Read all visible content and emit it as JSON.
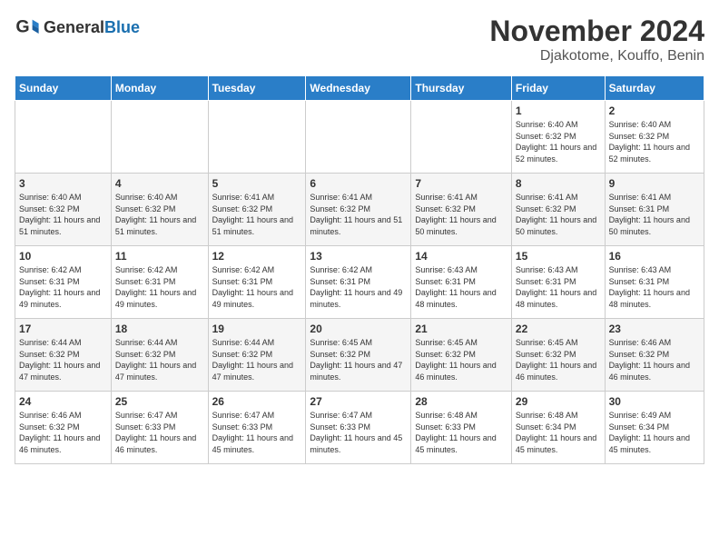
{
  "header": {
    "logo_general": "General",
    "logo_blue": "Blue",
    "month": "November 2024",
    "location": "Djakotome, Kouffo, Benin"
  },
  "days_of_week": [
    "Sunday",
    "Monday",
    "Tuesday",
    "Wednesday",
    "Thursday",
    "Friday",
    "Saturday"
  ],
  "weeks": [
    [
      {
        "day": "",
        "info": ""
      },
      {
        "day": "",
        "info": ""
      },
      {
        "day": "",
        "info": ""
      },
      {
        "day": "",
        "info": ""
      },
      {
        "day": "",
        "info": ""
      },
      {
        "day": "1",
        "info": "Sunrise: 6:40 AM\nSunset: 6:32 PM\nDaylight: 11 hours and 52 minutes."
      },
      {
        "day": "2",
        "info": "Sunrise: 6:40 AM\nSunset: 6:32 PM\nDaylight: 11 hours and 52 minutes."
      }
    ],
    [
      {
        "day": "3",
        "info": "Sunrise: 6:40 AM\nSunset: 6:32 PM\nDaylight: 11 hours and 51 minutes."
      },
      {
        "day": "4",
        "info": "Sunrise: 6:40 AM\nSunset: 6:32 PM\nDaylight: 11 hours and 51 minutes."
      },
      {
        "day": "5",
        "info": "Sunrise: 6:41 AM\nSunset: 6:32 PM\nDaylight: 11 hours and 51 minutes."
      },
      {
        "day": "6",
        "info": "Sunrise: 6:41 AM\nSunset: 6:32 PM\nDaylight: 11 hours and 51 minutes."
      },
      {
        "day": "7",
        "info": "Sunrise: 6:41 AM\nSunset: 6:32 PM\nDaylight: 11 hours and 50 minutes."
      },
      {
        "day": "8",
        "info": "Sunrise: 6:41 AM\nSunset: 6:32 PM\nDaylight: 11 hours and 50 minutes."
      },
      {
        "day": "9",
        "info": "Sunrise: 6:41 AM\nSunset: 6:31 PM\nDaylight: 11 hours and 50 minutes."
      }
    ],
    [
      {
        "day": "10",
        "info": "Sunrise: 6:42 AM\nSunset: 6:31 PM\nDaylight: 11 hours and 49 minutes."
      },
      {
        "day": "11",
        "info": "Sunrise: 6:42 AM\nSunset: 6:31 PM\nDaylight: 11 hours and 49 minutes."
      },
      {
        "day": "12",
        "info": "Sunrise: 6:42 AM\nSunset: 6:31 PM\nDaylight: 11 hours and 49 minutes."
      },
      {
        "day": "13",
        "info": "Sunrise: 6:42 AM\nSunset: 6:31 PM\nDaylight: 11 hours and 49 minutes."
      },
      {
        "day": "14",
        "info": "Sunrise: 6:43 AM\nSunset: 6:31 PM\nDaylight: 11 hours and 48 minutes."
      },
      {
        "day": "15",
        "info": "Sunrise: 6:43 AM\nSunset: 6:31 PM\nDaylight: 11 hours and 48 minutes."
      },
      {
        "day": "16",
        "info": "Sunrise: 6:43 AM\nSunset: 6:31 PM\nDaylight: 11 hours and 48 minutes."
      }
    ],
    [
      {
        "day": "17",
        "info": "Sunrise: 6:44 AM\nSunset: 6:32 PM\nDaylight: 11 hours and 47 minutes."
      },
      {
        "day": "18",
        "info": "Sunrise: 6:44 AM\nSunset: 6:32 PM\nDaylight: 11 hours and 47 minutes."
      },
      {
        "day": "19",
        "info": "Sunrise: 6:44 AM\nSunset: 6:32 PM\nDaylight: 11 hours and 47 minutes."
      },
      {
        "day": "20",
        "info": "Sunrise: 6:45 AM\nSunset: 6:32 PM\nDaylight: 11 hours and 47 minutes."
      },
      {
        "day": "21",
        "info": "Sunrise: 6:45 AM\nSunset: 6:32 PM\nDaylight: 11 hours and 46 minutes."
      },
      {
        "day": "22",
        "info": "Sunrise: 6:45 AM\nSunset: 6:32 PM\nDaylight: 11 hours and 46 minutes."
      },
      {
        "day": "23",
        "info": "Sunrise: 6:46 AM\nSunset: 6:32 PM\nDaylight: 11 hours and 46 minutes."
      }
    ],
    [
      {
        "day": "24",
        "info": "Sunrise: 6:46 AM\nSunset: 6:32 PM\nDaylight: 11 hours and 46 minutes."
      },
      {
        "day": "25",
        "info": "Sunrise: 6:47 AM\nSunset: 6:33 PM\nDaylight: 11 hours and 46 minutes."
      },
      {
        "day": "26",
        "info": "Sunrise: 6:47 AM\nSunset: 6:33 PM\nDaylight: 11 hours and 45 minutes."
      },
      {
        "day": "27",
        "info": "Sunrise: 6:47 AM\nSunset: 6:33 PM\nDaylight: 11 hours and 45 minutes."
      },
      {
        "day": "28",
        "info": "Sunrise: 6:48 AM\nSunset: 6:33 PM\nDaylight: 11 hours and 45 minutes."
      },
      {
        "day": "29",
        "info": "Sunrise: 6:48 AM\nSunset: 6:34 PM\nDaylight: 11 hours and 45 minutes."
      },
      {
        "day": "30",
        "info": "Sunrise: 6:49 AM\nSunset: 6:34 PM\nDaylight: 11 hours and 45 minutes."
      }
    ]
  ]
}
